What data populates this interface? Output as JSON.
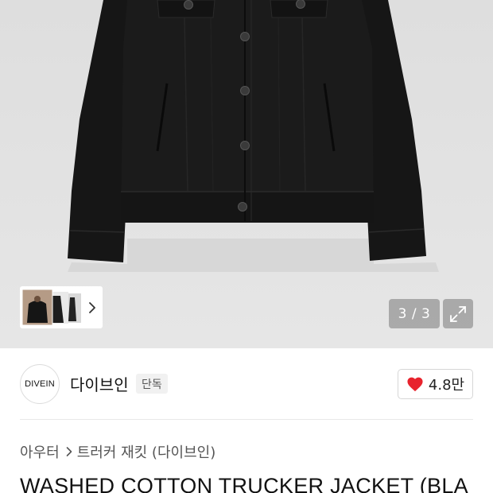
{
  "gallery": {
    "page_counter": "3 / 3",
    "current_page": 3,
    "total_pages": 3,
    "thumbnail_count": 3,
    "next_icon": "chevron-right-icon",
    "expand_icon": "expand-icon",
    "background_color": "#e3e3e3"
  },
  "brand": {
    "logo_text": "DIVEIN",
    "name": "다이브인",
    "tag": "단독",
    "likes": "4.8만",
    "like_icon": "heart-icon",
    "like_color": "#e8232d"
  },
  "breadcrumb": {
    "category": "아우터",
    "separator_icon": "chevron-right-icon",
    "subcategory": "트러커 재킷 (다이브인)"
  },
  "product": {
    "title": "WASHED COTTON TRUCKER JACKET (BLA"
  }
}
